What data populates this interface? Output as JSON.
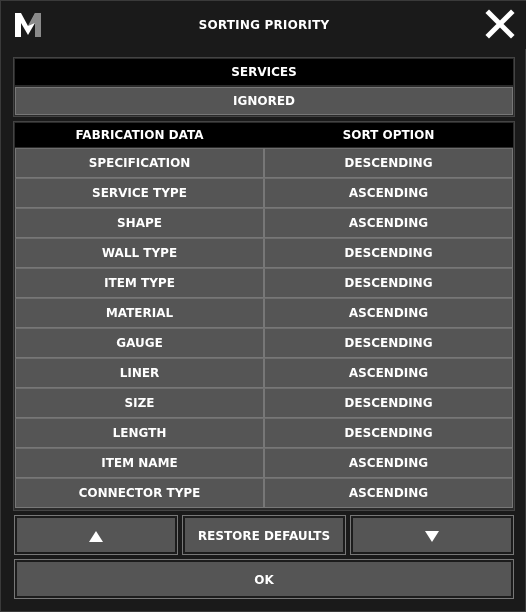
{
  "window": {
    "title": "SORTING PRIORITY"
  },
  "services": {
    "header": "SERVICES",
    "value": "IGNORED"
  },
  "table": {
    "columns": [
      "FABRICATION DATA",
      "SORT OPTION"
    ],
    "rows": [
      {
        "field": "SPECIFICATION",
        "option": "DESCENDING"
      },
      {
        "field": "SERVICE TYPE",
        "option": "ASCENDING"
      },
      {
        "field": "SHAPE",
        "option": "ASCENDING"
      },
      {
        "field": "WALL TYPE",
        "option": "DESCENDING"
      },
      {
        "field": "ITEM TYPE",
        "option": "DESCENDING"
      },
      {
        "field": "MATERIAL",
        "option": "ASCENDING"
      },
      {
        "field": "GAUGE",
        "option": "DESCENDING"
      },
      {
        "field": "LINER",
        "option": "ASCENDING"
      },
      {
        "field": "SIZE",
        "option": "DESCENDING"
      },
      {
        "field": "LENGTH",
        "option": "DESCENDING"
      },
      {
        "field": "ITEM NAME",
        "option": "ASCENDING"
      },
      {
        "field": "CONNECTOR TYPE",
        "option": "ASCENDING"
      }
    ]
  },
  "buttons": {
    "up_icon": "triangle-up-icon",
    "restore_label": "RESTORE DEFAULTS",
    "down_icon": "triangle-down-icon",
    "ok_label": "OK"
  },
  "icons": {
    "logo": "m-logo-icon",
    "close": "close-icon"
  },
  "colors": {
    "window_bg": "#1a1a1a",
    "header_bg": "#000000",
    "cell_bg": "#555555",
    "text": "#ffffff"
  }
}
